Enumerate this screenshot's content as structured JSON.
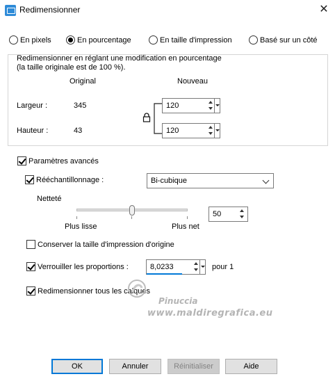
{
  "window": {
    "title": "Redimensionner",
    "close_glyph": "✕",
    "icon": "resize-app-icon"
  },
  "mode_radios": [
    {
      "label": "En pixels",
      "selected": false
    },
    {
      "label": "En pourcentage",
      "selected": true
    },
    {
      "label": "En taille d'impression",
      "selected": false
    },
    {
      "label": "Basé sur un côté",
      "selected": false
    }
  ],
  "group": {
    "desc_line1": "Redimensionner en réglant une modification en pourcentage",
    "desc_line2": "(la taille originale est de 100 %).",
    "col_original": "Original",
    "col_new": "Nouveau",
    "width_label": "Largeur :",
    "width_original": "345",
    "width_new": "120",
    "height_label": "Hauteur :",
    "height_original": "43",
    "height_new": "120"
  },
  "advanced": {
    "label": "Paramètres avancés",
    "checked": true,
    "resample_label": "Rééchantillonnage :",
    "resample_checked": true,
    "resample_value": "Bi-cubique",
    "sharpness_label": "Netteté",
    "sharpness_value": "50",
    "sharpness_level": 0.5,
    "slider_left_label": "Plus lisse",
    "slider_right_label": "Plus net",
    "keep_print_label": "Conserver la taille d'impression d'origine",
    "keep_print_checked": false,
    "lock_label": "Verrouiller les proportions :",
    "lock_checked": true,
    "lock_value": "8,0233",
    "lock_suffix": "pour 1",
    "resize_layers_label": "Redimensionner tous les calques",
    "resize_layers_checked": true
  },
  "buttons": {
    "ok": "OK",
    "cancel": "Annuler",
    "reset": "Réinitialiser",
    "help": "Aide"
  },
  "watermark": {
    "line1": "Pinuccia",
    "line2": "www.maldiregrafica.eu"
  },
  "colors": {
    "accent": "#0078d7",
    "button_bg": "#e1e1e1",
    "group_border": "#d5d5d5"
  }
}
